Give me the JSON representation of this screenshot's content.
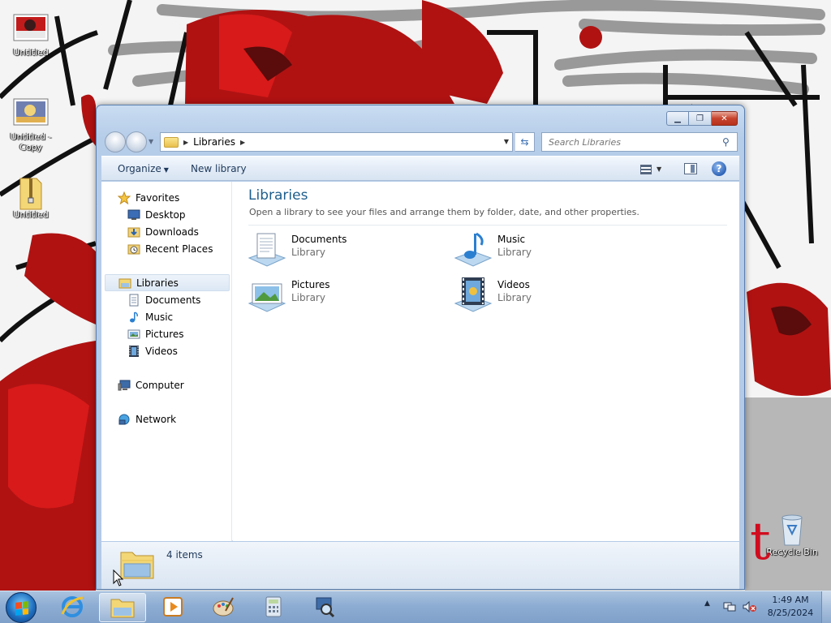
{
  "desktop": {
    "icons": [
      {
        "label": "Untitled"
      },
      {
        "label": "Untitled - Copy"
      },
      {
        "label": "Untitled"
      },
      {
        "label": "Recycle Bin"
      }
    ],
    "watermark_letter": "t"
  },
  "window": {
    "address": {
      "crumb": "Libraries"
    },
    "search": {
      "placeholder": "Search Libraries"
    },
    "toolbar": {
      "organize_label": "Organize",
      "new_library_label": "New library"
    },
    "nav_pane": {
      "items": [
        {
          "label": "Favorites",
          "icon": "star-icon"
        },
        {
          "label": "Desktop",
          "icon": "desktop-icon"
        },
        {
          "label": "Downloads",
          "icon": "downloads-icon"
        },
        {
          "label": "Recent Places",
          "icon": "recent-places-icon"
        },
        {
          "label": "Libraries",
          "icon": "libraries-icon"
        },
        {
          "label": "Documents",
          "icon": "documents-icon"
        },
        {
          "label": "Music",
          "icon": "music-icon"
        },
        {
          "label": "Pictures",
          "icon": "pictures-icon"
        },
        {
          "label": "Videos",
          "icon": "videos-icon"
        },
        {
          "label": "Computer",
          "icon": "computer-icon"
        },
        {
          "label": "Network",
          "icon": "network-icon"
        }
      ]
    },
    "content": {
      "title": "Libraries",
      "subtitle": "Open a library to see your files and arrange them by folder, date, and other properties.",
      "libraries": [
        {
          "name": "Documents",
          "kind": "Library"
        },
        {
          "name": "Music",
          "kind": "Library"
        },
        {
          "name": "Pictures",
          "kind": "Library"
        },
        {
          "name": "Videos",
          "kind": "Library"
        }
      ]
    },
    "status": {
      "item_count": "4 items"
    }
  },
  "taskbar": {
    "clock": {
      "time": "1:49 AM",
      "date": "8/25/2024"
    }
  },
  "colors": {
    "title_accent": "#1e5e8c",
    "taskbar": "#8eadd3",
    "close_button": "#c7432d"
  }
}
